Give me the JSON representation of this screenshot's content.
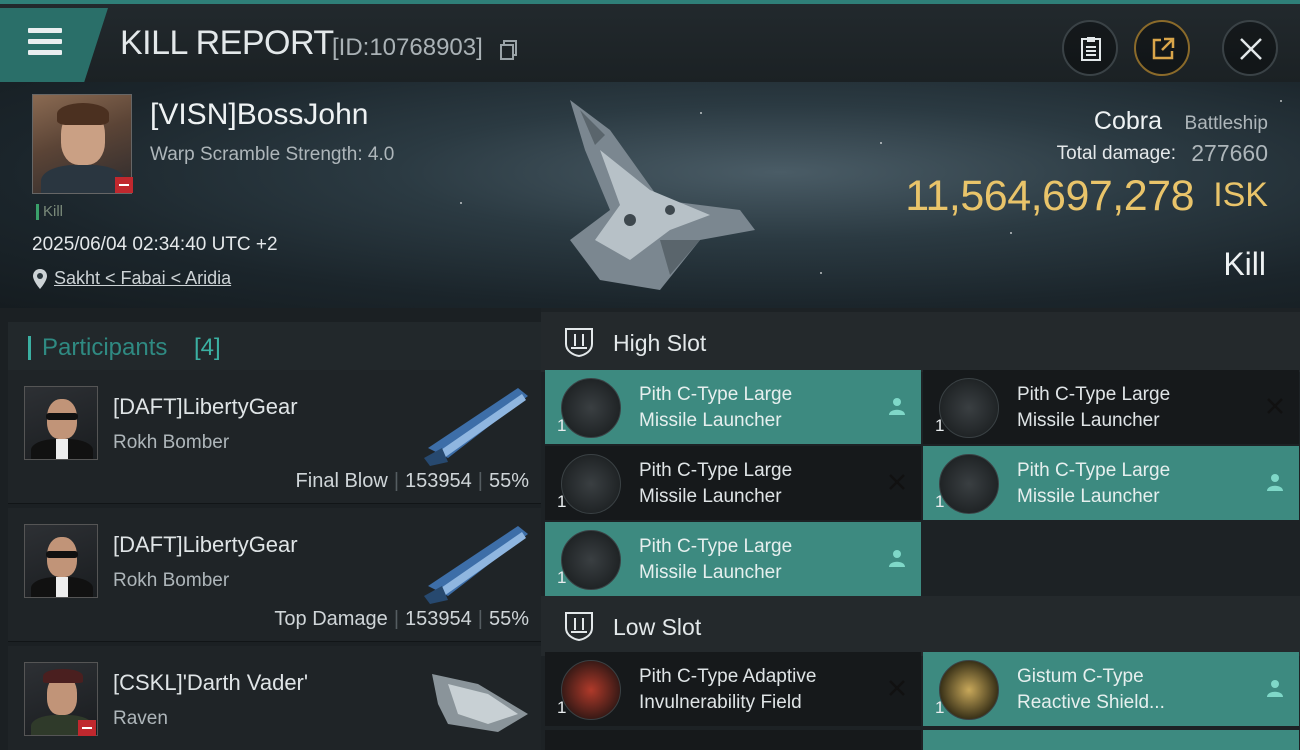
{
  "header": {
    "title": "KILL REPORT",
    "report_id": "[ID:10768903]"
  },
  "victim": {
    "name": "[VISN]BossJohn",
    "subtitle": "Warp Scramble Strength: 4.0",
    "tag": "Kill",
    "datetime": "2025/06/04 02:34:40 UTC +2",
    "location": "Sakht < Fabai < Aridia",
    "ship_name": "Cobra",
    "ship_class": "Battleship",
    "damage_label": "Total damage:",
    "damage_value": "277660",
    "isk_value": "11,564,697,278",
    "isk_unit": "ISK",
    "result": "Kill"
  },
  "participants": {
    "title": "Participants",
    "count": "[4]",
    "items": [
      {
        "name": "[DAFT]LibertyGear",
        "ship": "Rokh Bomber",
        "role": "Final Blow",
        "damage": "153954",
        "percent": "55%"
      },
      {
        "name": "[DAFT]LibertyGear",
        "ship": "Rokh Bomber",
        "role": "Top Damage",
        "damage": "153954",
        "percent": "55%"
      },
      {
        "name": "[CSKL]'Darth Vader'",
        "ship": "Raven"
      }
    ]
  },
  "slots": {
    "high": {
      "label": "High Slot",
      "modules": [
        {
          "line1": "Pith C-Type Large",
          "line2": "Missile Launcher",
          "qty": "1",
          "state": "person-icon"
        },
        {
          "line1": "Pith C-Type Large",
          "line2": "Missile Launcher",
          "qty": "1",
          "state": "x-icon"
        },
        {
          "line1": "Pith C-Type Large",
          "line2": "Missile Launcher",
          "qty": "1",
          "state": "x-icon"
        },
        {
          "line1": "Pith C-Type Large",
          "line2": "Missile Launcher",
          "qty": "1",
          "state": "person-icon"
        },
        {
          "line1": "Pith C-Type Large",
          "line2": "Missile Launcher",
          "qty": "1",
          "state": "person-icon"
        }
      ]
    },
    "low": {
      "label": "Low Slot",
      "modules": [
        {
          "line1": "Pith C-Type Adaptive",
          "line2": "Invulnerability Field",
          "qty": "1",
          "state": "x-icon"
        },
        {
          "line1": "Gistum C-Type",
          "line2": "Reactive Shield...",
          "qty": "1",
          "state": "person-icon"
        }
      ]
    }
  },
  "colors": {
    "accent": "#3d8a80",
    "isk": "#e9c46a",
    "badge": "#c0282e"
  }
}
